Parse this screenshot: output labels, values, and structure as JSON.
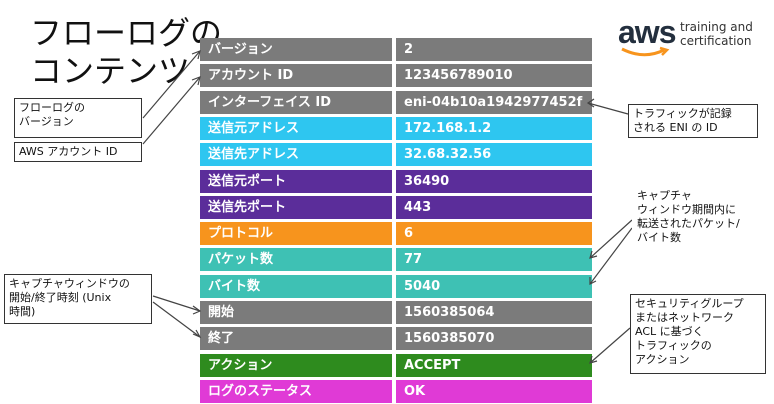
{
  "title": {
    "line1": "フローログの",
    "line2": "コンテンツ"
  },
  "logo": {
    "brand": "aws",
    "line1": "training and",
    "line2": "certification"
  },
  "rows": [
    {
      "key": "バージョン",
      "value": "2",
      "color": "#7b7b7b"
    },
    {
      "key": "アカウント ID",
      "value": "123456789010",
      "color": "#7b7b7b"
    },
    {
      "key": "インターフェイス ID",
      "value": "eni-04b10a1942977452f",
      "color": "#7b7b7b"
    },
    {
      "key": "送信元アドレス",
      "value": "172.168.1.2",
      "color": "#2ec6f0"
    },
    {
      "key": "送信先アドレス",
      "value": "32.68.32.56",
      "color": "#2ec6f0"
    },
    {
      "key": "送信元ポート",
      "value": "36490",
      "color": "#5b2d9a"
    },
    {
      "key": "送信先ポート",
      "value": "443",
      "color": "#5b2d9a"
    },
    {
      "key": "プロトコル",
      "value": "6",
      "color": "#f7941d"
    },
    {
      "key": "パケット数",
      "value": "77",
      "color": "#3ec1b4"
    },
    {
      "key": "バイト数",
      "value": "5040",
      "color": "#3ec1b4"
    },
    {
      "key": "開始",
      "value": "1560385064",
      "color": "#7b7b7b"
    },
    {
      "key": "終了",
      "value": "1560385070",
      "color": "#7b7b7b"
    },
    {
      "key": "アクション",
      "value": "ACCEPT",
      "color": "#2e8b1e"
    },
    {
      "key": "ログのステータス",
      "value": "OK",
      "color": "#e03ad6"
    }
  ],
  "callouts": {
    "version": "フローログの\nバージョン",
    "account": "AWS アカウント ID",
    "eni": "トラフィックが記録\nされる ENI の ID",
    "capture_window": "キャプチャ\nウィンドウ期間内に\n転送されたパケット/\nバイト数",
    "time": "キャプチャウィンドウの\n開始/終了時刻 (Unix\n時間)",
    "action": "セキュリティグループ\nまたはネットワーク\nACL に基づく\nトラフィックの\nアクション"
  }
}
